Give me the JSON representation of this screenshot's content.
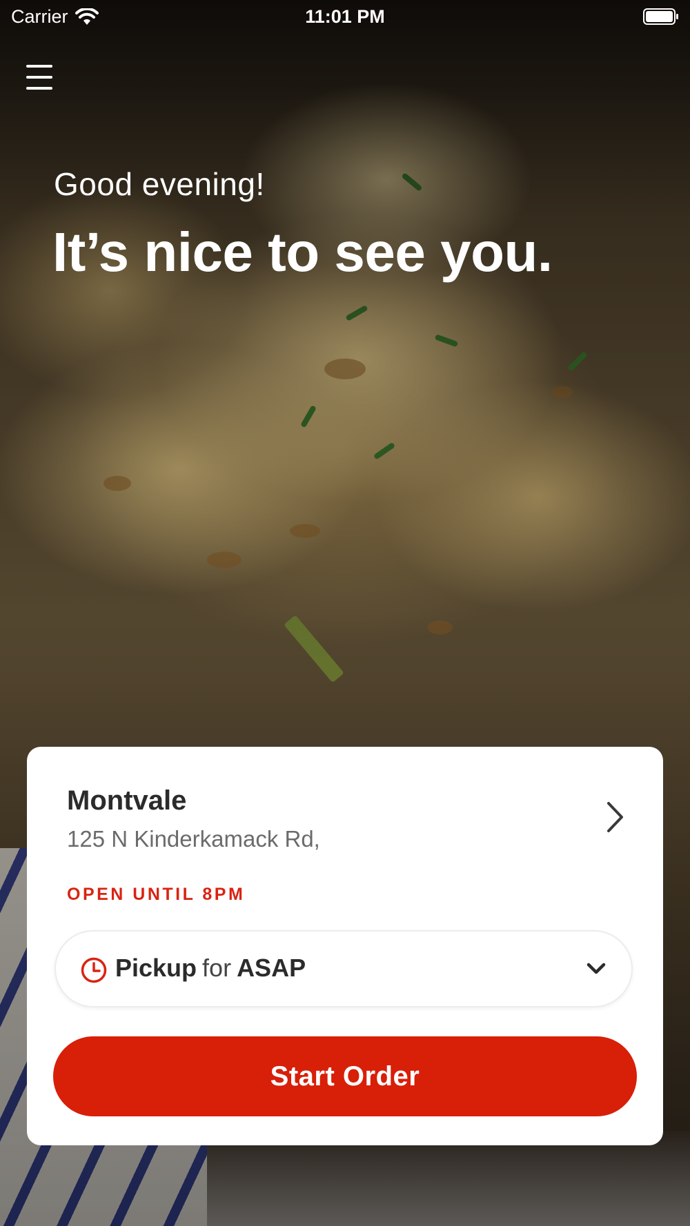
{
  "status_bar": {
    "carrier": "Carrier",
    "time": "11:01 PM",
    "wifi_icon": "wifi-icon",
    "battery_icon": "battery-icon"
  },
  "header": {
    "menu_icon": "hamburger-menu-icon"
  },
  "hero": {
    "greeting": "Good evening!",
    "headline": "It’s nice to see you."
  },
  "location": {
    "name": "Montvale",
    "address": "125 N Kinderkamack Rd,",
    "status": "OPEN UNTIL 8PM",
    "chevron_icon": "chevron-right-icon"
  },
  "order_type": {
    "mode": "Pickup",
    "connector": "for",
    "time": "ASAP",
    "clock_icon": "clock-icon",
    "chevron_icon": "chevron-down-icon"
  },
  "cta": {
    "label": "Start Order"
  },
  "colors": {
    "accent": "#d81f08",
    "status_red": "#d92312",
    "card_bg": "#ffffff",
    "title_text": "#2b2b2b",
    "secondary_text": "#6b6b6b"
  }
}
